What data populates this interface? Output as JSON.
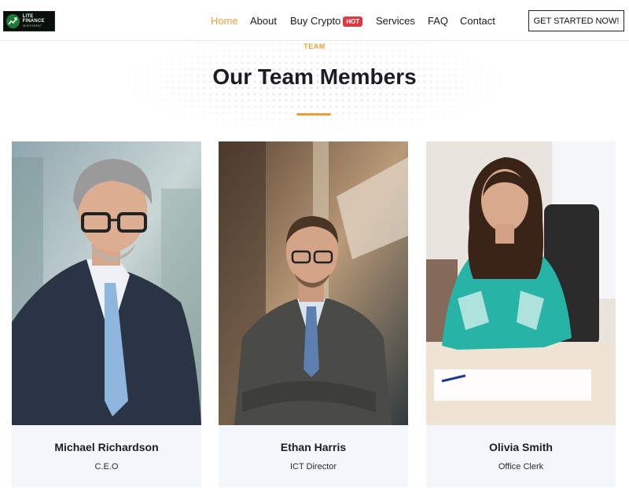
{
  "header": {
    "logo": {
      "line1": "LITE FINANCE",
      "line2": "INVESTMENT"
    },
    "nav": [
      {
        "label": "Home",
        "active": true
      },
      {
        "label": "About",
        "active": false
      },
      {
        "label": "Buy Crypto",
        "badge": "HOT",
        "active": false
      },
      {
        "label": "Services",
        "active": false
      },
      {
        "label": "FAQ",
        "active": false
      },
      {
        "label": "Contact",
        "active": false
      }
    ],
    "cta_label": "GET STARTED NOW!"
  },
  "section": {
    "eyebrow": "TEAM",
    "title": "Our Team Members"
  },
  "team": [
    {
      "name": "Michael Richardson",
      "role": "C.E.O"
    },
    {
      "name": "Ethan Harris",
      "role": "ICT Director"
    },
    {
      "name": "Olivia Smith",
      "role": "Office Clerk"
    }
  ],
  "colors": {
    "accent": "#e8a13a",
    "hot_badge": "#e3343f",
    "card_footer": "#f3f7fb",
    "title": "#1b1d22"
  },
  "icons": [
    "logo-chart-icon"
  ]
}
